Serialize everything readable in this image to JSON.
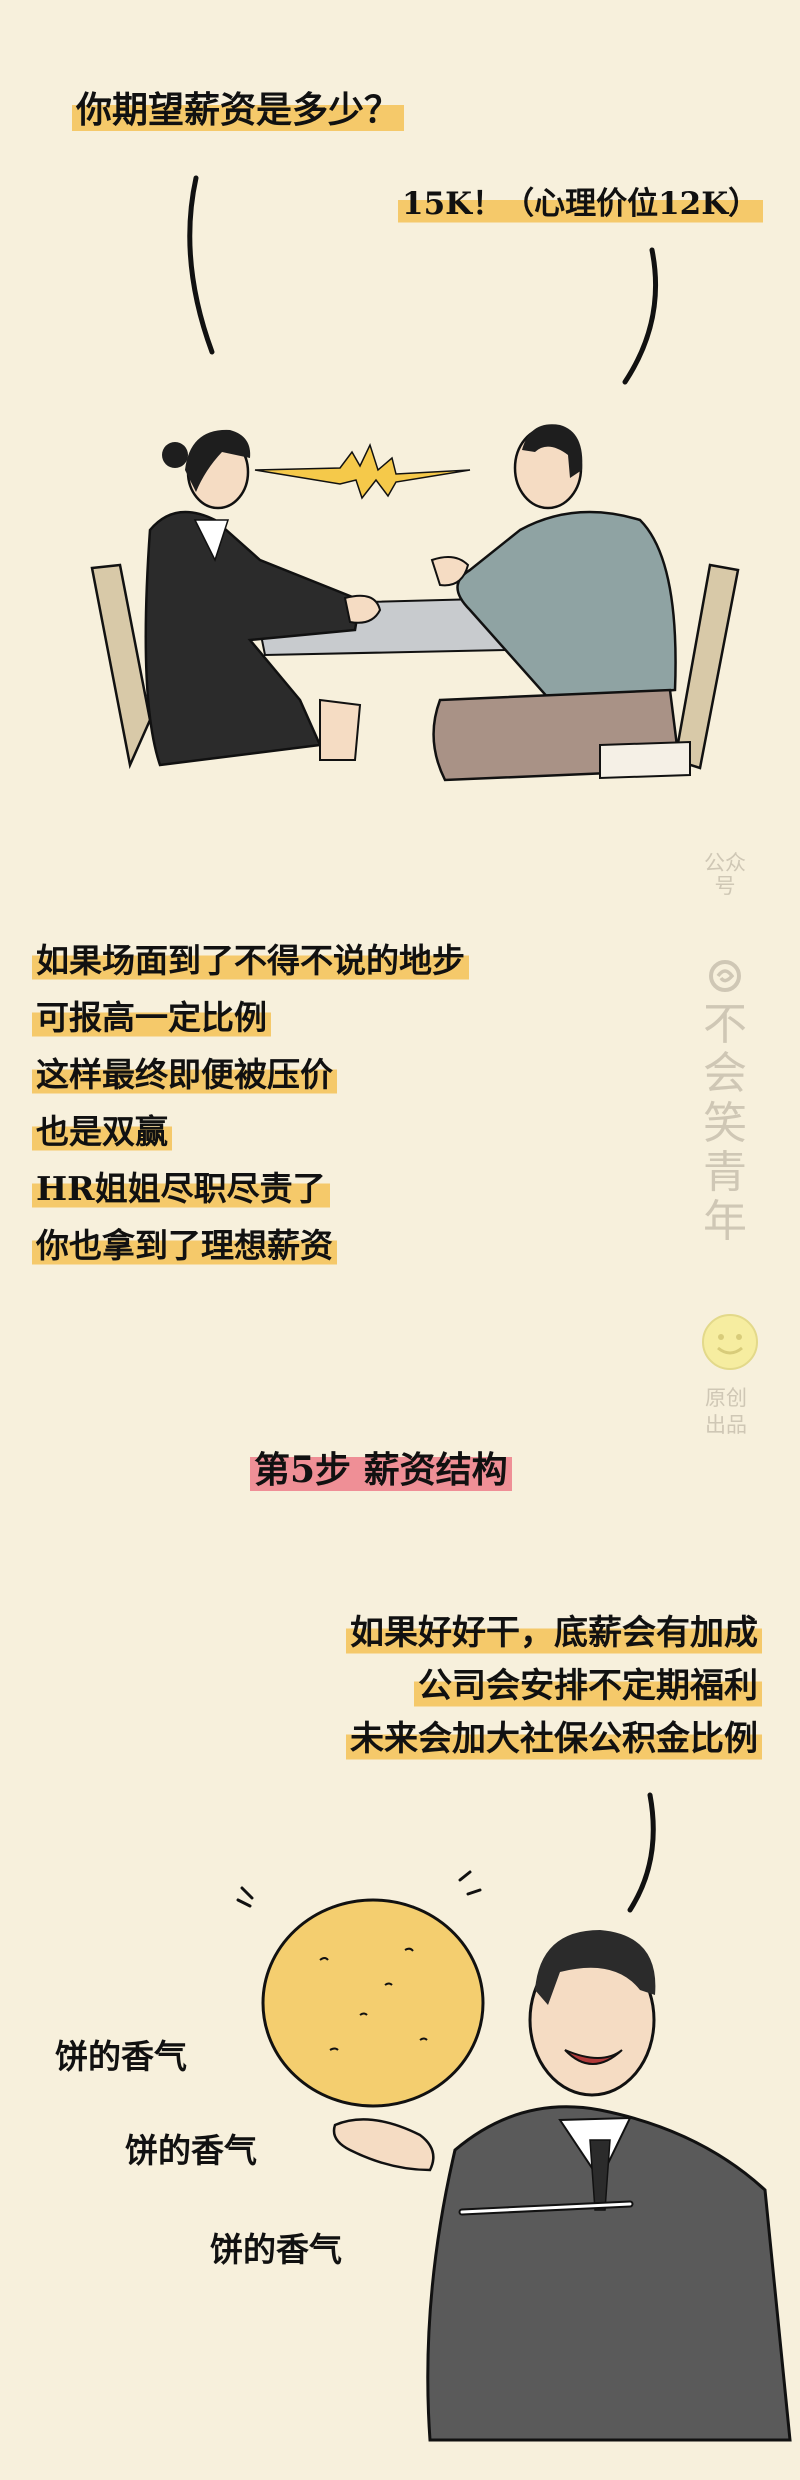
{
  "scene1": {
    "question": "你期望薪资是多少？",
    "answer": "15K！（心理价位12K）"
  },
  "scene2": {
    "lines": [
      "如果场面到了不得不说的地步",
      "可报高一定比例",
      "这样最终即便被压价",
      "也是双赢",
      "HR姐姐尽职尽责了",
      "你也拿到了理想薪资"
    ]
  },
  "watermark": {
    "top": "公众号",
    "icon": "spiral-logo-icon",
    "name": "不会笑青年",
    "bottom": "原创出品",
    "face": "smiley-icon"
  },
  "section": {
    "title": "第5步 薪资结构"
  },
  "scene3": {
    "lines": [
      "如果好好干，底薪会有加成",
      "公司会安排不定期福利",
      "未来会加大社保公积金比例"
    ],
    "aroma": [
      "饼的香气",
      "饼的香气",
      "饼的香气"
    ]
  },
  "colors": {
    "background": "#f7f0dc",
    "highlight": "#f5c96a",
    "highlight_pink": "#ef8f96"
  }
}
